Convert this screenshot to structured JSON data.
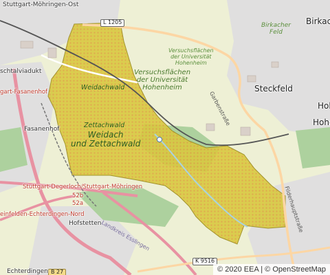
{
  "map": {
    "colors": {
      "background": "#f2efe9",
      "farmland": "#eef0d5",
      "forest": "#add19e",
      "residential": "#e0dfdf",
      "highway": "#e892a2",
      "primary": "#fcd6a4",
      "railway": "#555555",
      "protected_area_fill": "#d4c43a",
      "protected_area_stroke": "#9a8a1c"
    },
    "labels": {
      "stuttgart_mohringen_ost": "Stuttgart-Möhringen-Ost",
      "l1205": "L 1205",
      "birkach": "Birkach",
      "birkacher_feld_1": "Birkacher",
      "birkacher_feld_2": "Feld",
      "schtalviadukt": "schtalviadukt",
      "versuchsflachen_small_1": "Versuchsflächen",
      "versuchsflachen_small_2": "der Universität",
      "versuchsflachen_small_3": "Hohenheim",
      "versuchsflachen_big_1": "Versuchsflächen",
      "versuchsflachen_big_2": "der Universität",
      "versuchsflachen_big_3": "Hohenheim",
      "fasanenhof_red": "gart-Fasanenhof",
      "weidachwald": "Weidachwald",
      "steckfeld": "Steckfeld",
      "garbenstrasse": "Garbenstraße",
      "hoh_1": "Hoh",
      "hoh_2": "Hohe",
      "fasanenhof": "Fasanenhof",
      "zettachwald": "Zettachwald",
      "weidach_1": "Weidach",
      "weidach_2": "und Zettachwald",
      "degerloch_red": "Stuttgart-Degerloch/Stuttgart-Möhringen",
      "exit_52b": "52b",
      "exit_52a": "52a",
      "leinfelden_red": "einfelden-Echterdingen-Nord",
      "hofstetten": "Hofstetten",
      "landkreis": "Landkreis Esslingen",
      "filderhauptstrasse": "Filderhauptstraße",
      "k9516": "K 9516",
      "b27": "B 27",
      "echterdingen": "Echterdingen"
    },
    "attribution": {
      "eea": "© 2020 EEA",
      "separator": "|",
      "osm": "© OpenStreetMap"
    }
  }
}
